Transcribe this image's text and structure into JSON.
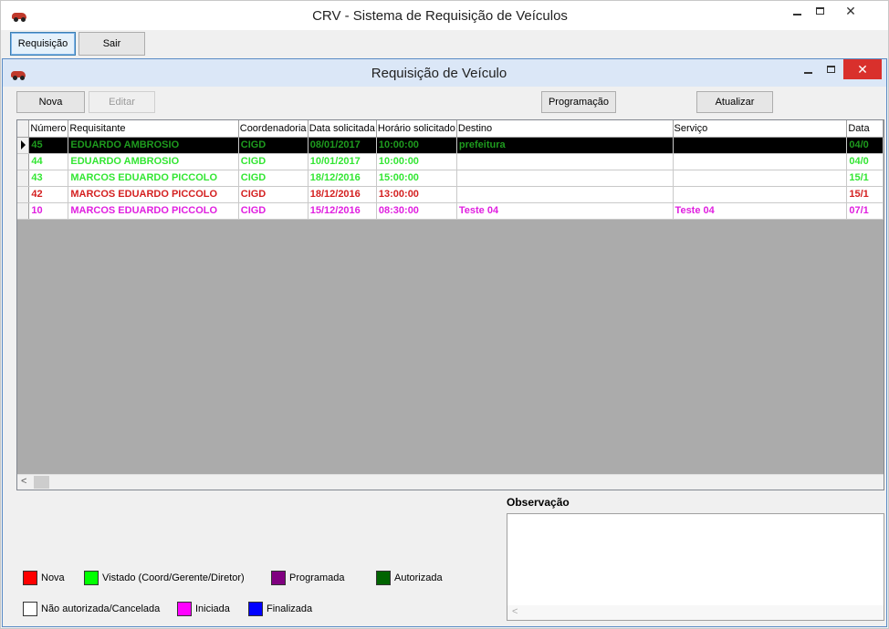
{
  "outer": {
    "title": "CRV - Sistema de Requisição de Veículos",
    "buttons": {
      "requisicao": "Requisição",
      "sair": "Sair"
    }
  },
  "inner": {
    "title": "Requisição de Veículo",
    "buttons": {
      "nova": "Nova",
      "editar": "Editar",
      "programacao": "Programação",
      "atualizar": "Atualizar"
    }
  },
  "grid": {
    "columns": [
      "Número",
      "Requisitante",
      "Coordenadoria",
      "Data solicitada",
      "Horário solicitado",
      "Destino",
      "Serviço",
      "Data"
    ],
    "rows": [
      {
        "cells": [
          "45",
          "EDUARDO AMBROSIO",
          "CIGD",
          "08/01/2017",
          "10:00:00",
          "prefeitura",
          "",
          "04/0"
        ],
        "color": "#1e9b1e",
        "selected": true
      },
      {
        "cells": [
          "44",
          "EDUARDO AMBROSIO",
          "CIGD",
          "10/01/2017",
          "10:00:00",
          "",
          "",
          "04/0"
        ],
        "color": "#33e633",
        "selected": false
      },
      {
        "cells": [
          "43",
          "MARCOS EDUARDO PICCOLO",
          "CIGD",
          "18/12/2016",
          "15:00:00",
          "",
          "",
          "15/1"
        ],
        "color": "#33e633",
        "selected": false
      },
      {
        "cells": [
          "42",
          "MARCOS EDUARDO PICCOLO",
          "CIGD",
          "18/12/2016",
          "13:00:00",
          "",
          "",
          "15/1"
        ],
        "color": "#d42020",
        "selected": false
      },
      {
        "cells": [
          "10",
          "MARCOS EDUARDO PICCOLO",
          "CIGD",
          "15/12/2016",
          "08:30:00",
          "Teste 04",
          "Teste 04",
          "07/1"
        ],
        "color": "#e020e0",
        "selected": false
      }
    ]
  },
  "observacao": {
    "label": "Observação",
    "value": ""
  },
  "legend": [
    {
      "label": "Nova",
      "color": "#ff0000"
    },
    {
      "label": "Vistado (Coord/Gerente/Diretor)",
      "color": "#00ff00"
    },
    {
      "label": "Programada",
      "color": "#800080"
    },
    {
      "label": "Autorizada",
      "color": "#006400"
    },
    {
      "label": "Não autorizada/Cancelada",
      "color": "#ffffff"
    },
    {
      "label": "Iniciada",
      "color": "#ff00ff"
    },
    {
      "label": "Finalizada",
      "color": "#0000ff"
    }
  ]
}
